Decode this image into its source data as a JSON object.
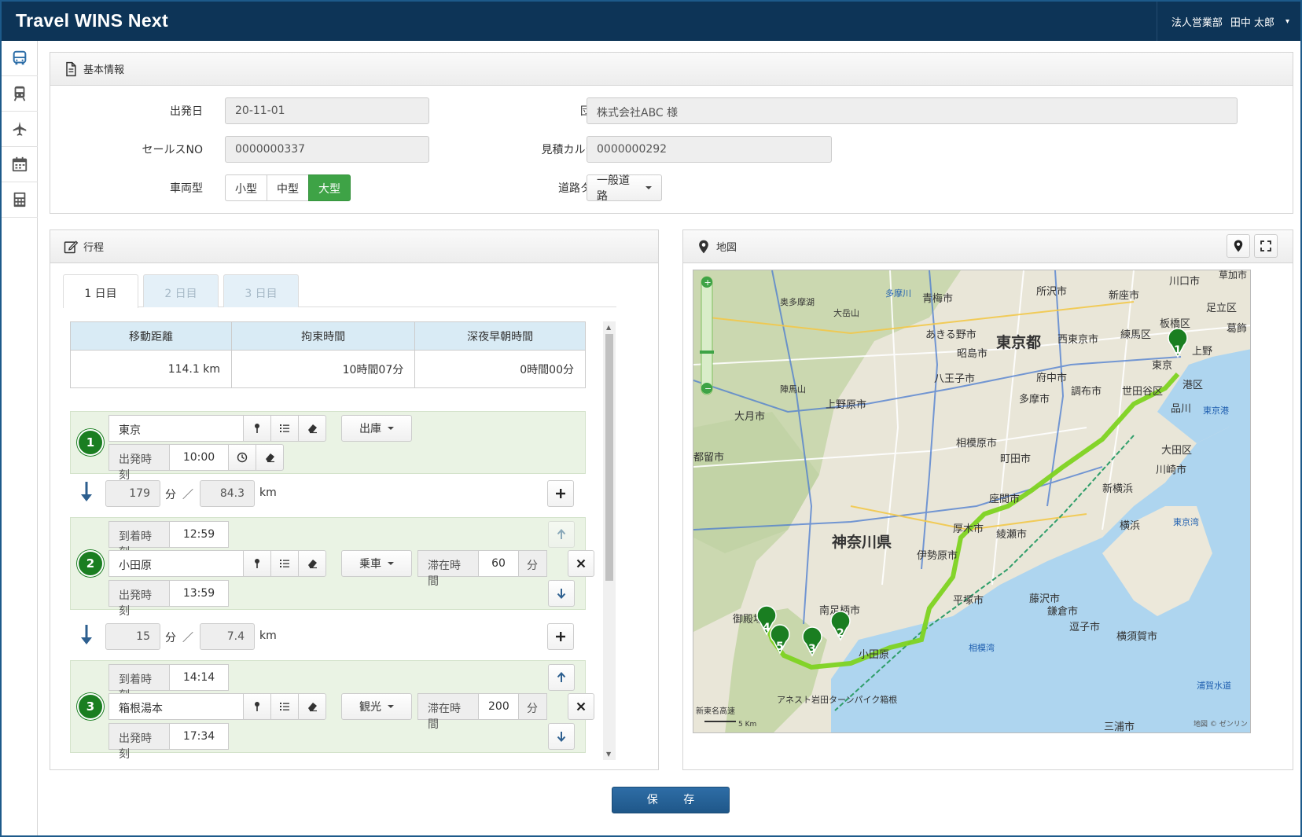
{
  "app": {
    "title": "Travel WINS Next"
  },
  "user": {
    "department": "法人営業部",
    "name": "田中 太郎"
  },
  "sidebar": {
    "icons": [
      "bus-icon",
      "train-icon",
      "airplane-icon",
      "calendar-icon",
      "calculator-icon"
    ]
  },
  "basic_info": {
    "title": "基本情報",
    "departure_date_label": "出発日",
    "departure_date": "20-11-01",
    "group_label": "団体名",
    "group_name": "株式会社ABC 様",
    "sales_no_label": "セールスNO",
    "sales_no": "0000000337",
    "estimate_no_label": "見積カルテNO",
    "estimate_no": "0000000292",
    "vehicle_label": "車両型",
    "vehicle_options": [
      "小型",
      "中型",
      "大型"
    ],
    "vehicle_selected": "大型",
    "road_label": "道路タイプ",
    "road_type": "一般道路"
  },
  "itinerary": {
    "title": "行程",
    "tabs": [
      "1 日目",
      "2 日目",
      "3 日目"
    ],
    "summary_headers": [
      "移動距離",
      "拘束時間",
      "深夜早朝時間"
    ],
    "summary_values": [
      "114.1 km",
      "10時間07分",
      "0時間00分"
    ],
    "arrival_label": "到着時刻",
    "departure_label": "出発時刻",
    "stay_label": "滞在時間",
    "minute_unit": "分",
    "km_unit": "km",
    "slash": "／",
    "stops": [
      {
        "num": "1",
        "place": "東京",
        "type": "出庫",
        "departure": "10:00"
      },
      {
        "num": "2",
        "place": "小田原",
        "type": "乗車",
        "arrival": "12:59",
        "departure": "13:59",
        "stay": "60"
      },
      {
        "num": "3",
        "place": "箱根湯本",
        "type": "観光",
        "arrival": "14:14",
        "departure": "17:34",
        "stay": "200"
      }
    ],
    "legs": [
      {
        "minutes": "179",
        "km": "84.3"
      },
      {
        "minutes": "15",
        "km": "7.4"
      }
    ]
  },
  "map": {
    "title": "地図",
    "labels": [
      "川口市",
      "草加市",
      "所沢市",
      "新座市",
      "青梅市",
      "多摩川",
      "足立区",
      "板橋区",
      "練馬区",
      "葛飾",
      "あきる野市",
      "東京都",
      "西東京市",
      "大岳山",
      "奥多摩湖",
      "昭島市",
      "東京",
      "上野",
      "港区",
      "八王子市",
      "府中市",
      "調布市",
      "世田谷区",
      "品川",
      "東京港",
      "多摩市",
      "陣馬山",
      "上野原市",
      "大月市",
      "相模原市",
      "大田区",
      "都留市",
      "町田市",
      "川崎市",
      "新横浜",
      "座間市",
      "厚木市",
      "綾瀬市",
      "横浜",
      "神奈川県",
      "伊勢原市",
      "東京湾",
      "平塚市",
      "藤沢市",
      "鎌倉市",
      "南足柄市",
      "御殿場市",
      "逗子市",
      "横須賀市",
      "小田原",
      "相模湾",
      "浦賀水道",
      "三浦市",
      "アネスト岩田ターンパイク箱根",
      "新東名高速",
      "5 Km",
      "地図 © ゼンリン"
    ],
    "markers": [
      "1",
      "2",
      "3",
      "4",
      "5"
    ]
  },
  "save_label": "保 存",
  "colors": {
    "header": "#0d3457",
    "active": "#3ea346",
    "stop_bg": "#eaf3e4",
    "marker": "#1a7e21",
    "route": "#7ed321"
  }
}
